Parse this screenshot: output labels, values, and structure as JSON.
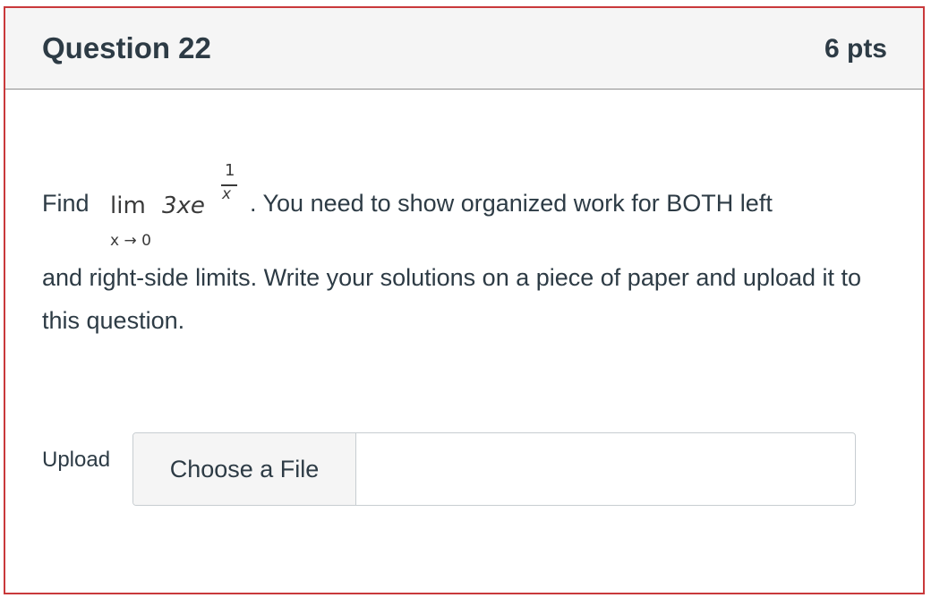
{
  "question": {
    "title": "Question 22",
    "points": "6 pts"
  },
  "body": {
    "find_word": "Find",
    "math": {
      "lim": "lim",
      "expression": "3xe",
      "exponent_numerator": "1",
      "exponent_denominator": "x",
      "limit_subscript": "x → 0"
    },
    "text_after_math": ". You need to show organized work for BOTH left",
    "text_rest": "and right-side limits. Write your solutions on a piece of paper and upload it to this question."
  },
  "upload": {
    "label": "Upload",
    "button_label": "Choose a File"
  }
}
